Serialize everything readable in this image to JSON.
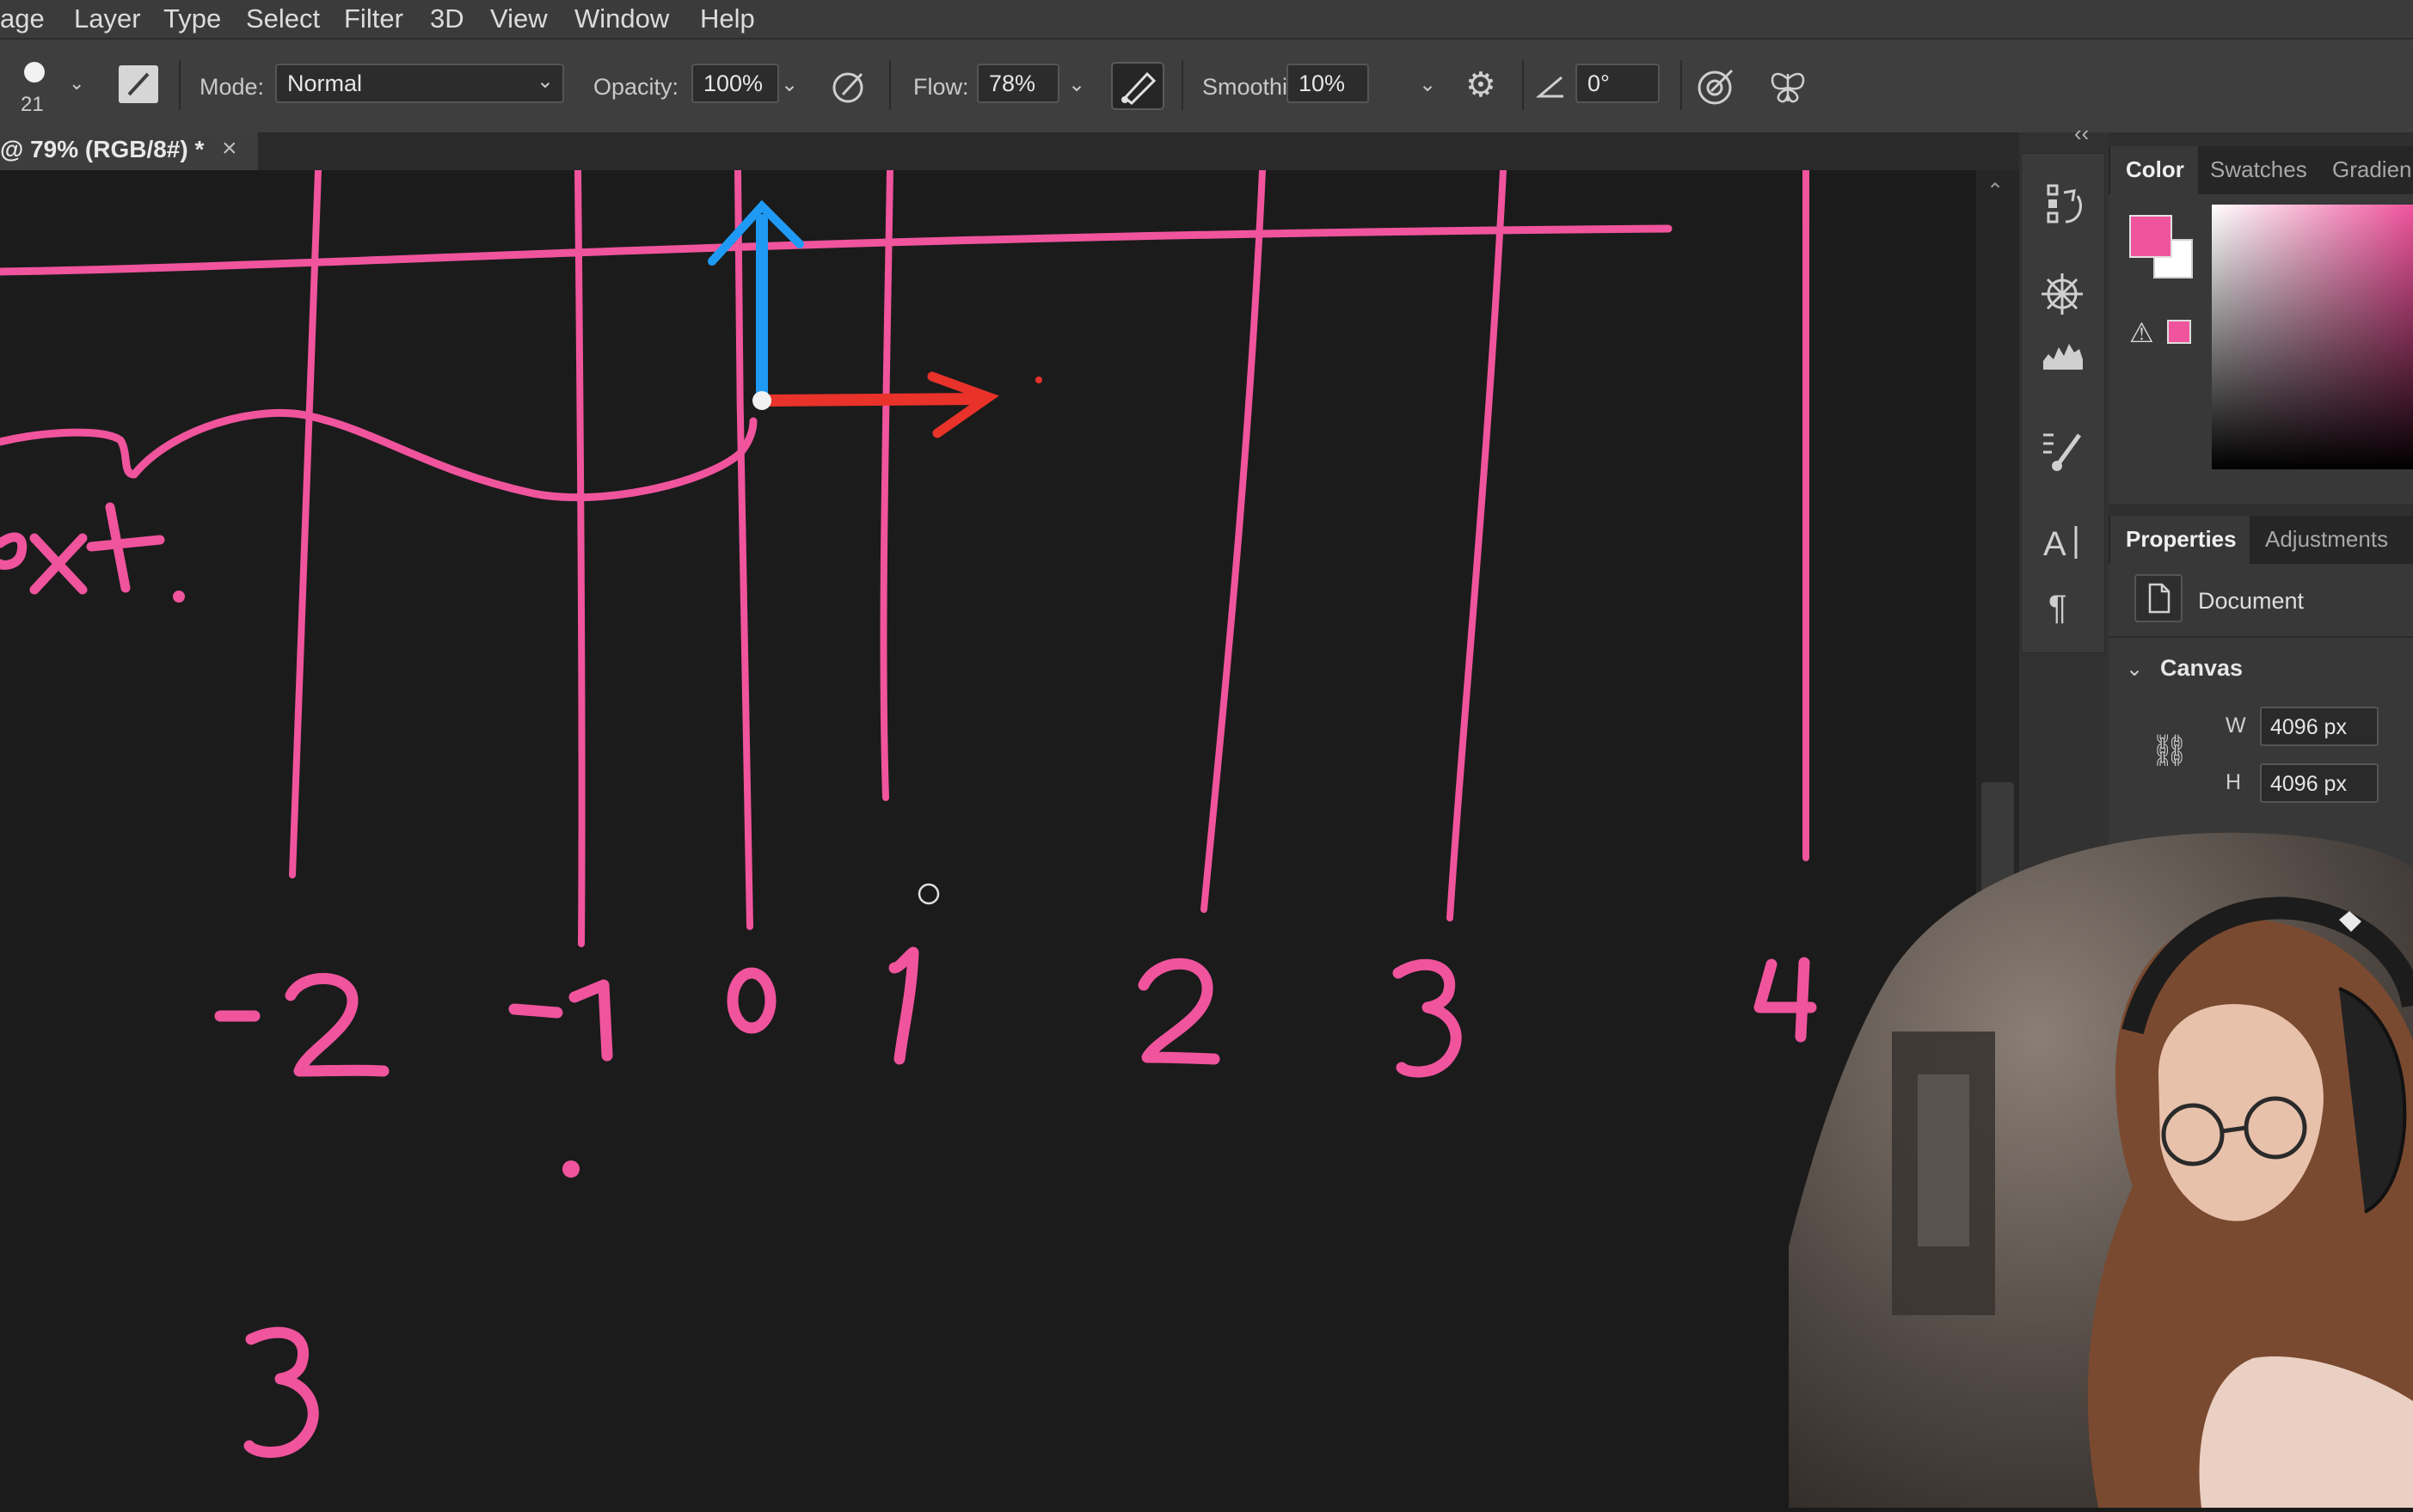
{
  "menubar": {
    "items": [
      "age",
      "Layer",
      "Type",
      "Select",
      "Filter",
      "3D",
      "View",
      "Window",
      "Help"
    ]
  },
  "options": {
    "brush_size": "21",
    "mode_label": "Mode:",
    "mode_value": "Normal",
    "opacity_label": "Opacity:",
    "opacity_value": "100%",
    "flow_label": "Flow:",
    "flow_value": "78%",
    "smoothing_label": "Smoothing:",
    "smoothing_value": "10%",
    "angle_value": "0°"
  },
  "document_tab": {
    "title": "@ 79% (RGB/8#) *",
    "close": "×"
  },
  "canvas_drawing": {
    "stroke_color": "#f0549d",
    "axis_x_color": "#e8322a",
    "axis_y_color": "#1e9af5",
    "partial_text": "ext.",
    "number_labels": [
      "-2",
      "-1",
      "0",
      "1",
      "2",
      "3",
      "4"
    ],
    "bottom_number": "3"
  },
  "panels": {
    "collapse": "‹‹",
    "color_tabs": [
      "Color",
      "Swatches",
      "Gradien"
    ],
    "foreground_color": "#f0549d",
    "background_color": "#ffffff",
    "properties_tabs": [
      "Properties",
      "Adjustments"
    ],
    "document_label": "Document",
    "canvas_section": "Canvas",
    "width_label": "W",
    "width_value": "4096 px",
    "height_label": "H",
    "height_value": "4096 px"
  }
}
